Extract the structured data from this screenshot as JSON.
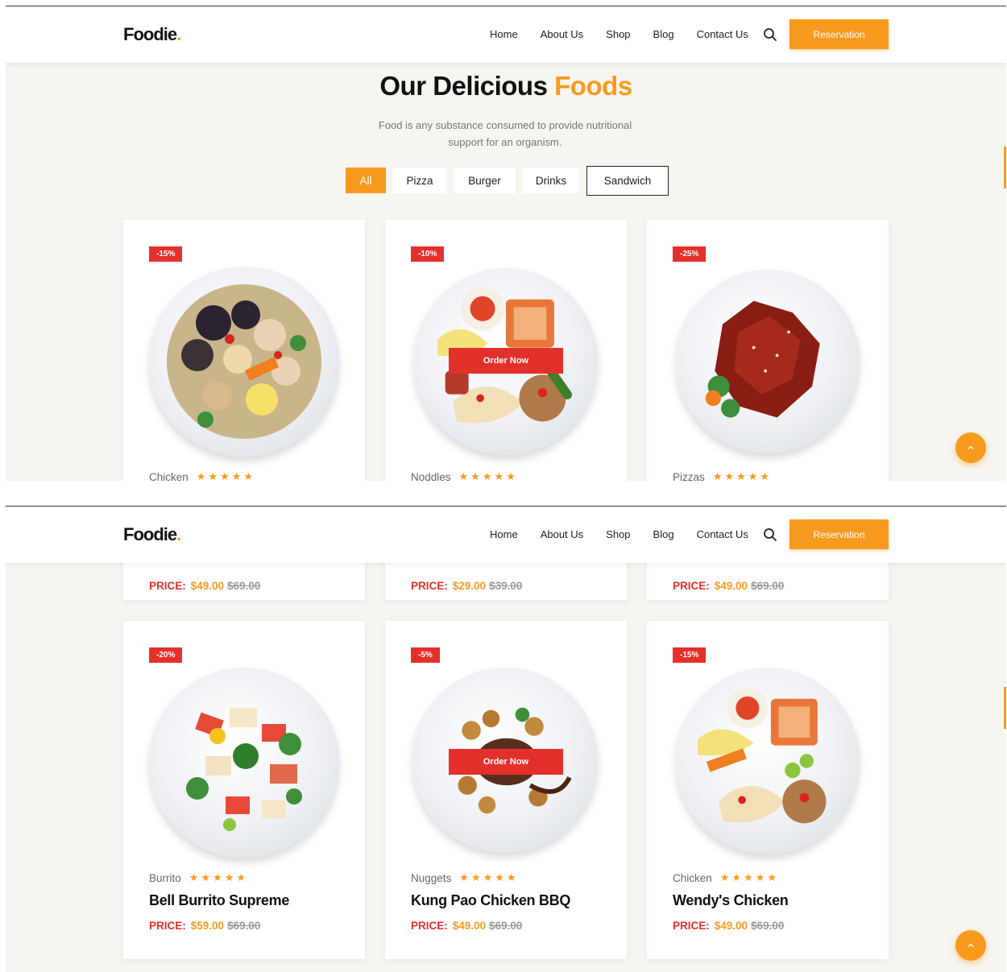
{
  "header": {
    "logo_text": "Foodie",
    "logo_dot": ".",
    "nav": [
      "Home",
      "About Us",
      "Shop",
      "Blog",
      "Contact Us"
    ],
    "search_icon": "search-icon",
    "reservation_label": "Reservation"
  },
  "section": {
    "title_main": "Our Delicious",
    "title_accent": "Foods",
    "subtitle": "Food is any substance consumed to provide nutritional support for an organism.",
    "filters": [
      "All",
      "Pizza",
      "Burger",
      "Drinks",
      "Sandwich"
    ]
  },
  "cards_top": [
    {
      "badge": "-15%",
      "category": "Chicken",
      "price_label": "PRICE:",
      "price": "$49.00",
      "old_price": "$69.00"
    },
    {
      "badge": "-10%",
      "category": "Noddles",
      "order_label": "Order Now",
      "price_label": "PRICE:",
      "price": "$29.00",
      "old_price": "$39.00"
    },
    {
      "badge": "-25%",
      "category": "Pizzas",
      "price_label": "PRICE:",
      "price": "$49.00",
      "old_price": "$69.00"
    }
  ],
  "cards_bottom": [
    {
      "badge": "-20%",
      "category": "Burrito",
      "name": "Bell Burrito Supreme",
      "price_label": "PRICE:",
      "price": "$59.00",
      "old_price": "$69.00"
    },
    {
      "badge": "-5%",
      "category": "Nuggets",
      "name": "Kung Pao Chicken BBQ",
      "order_label": "Order Now",
      "price_label": "PRICE:",
      "price": "$49.00",
      "old_price": "$69.00"
    },
    {
      "badge": "-15%",
      "category": "Chicken",
      "name": "Wendy's Chicken",
      "price_label": "PRICE:",
      "price": "$49.00",
      "old_price": "$69.00"
    }
  ],
  "stars": "★★★★★",
  "rating": 5,
  "colors": {
    "accent": "#f79a1e",
    "badge": "#e4302b",
    "background": "#f7f5f0"
  },
  "icons": {
    "back_to_top": "chevron-up-icon"
  }
}
